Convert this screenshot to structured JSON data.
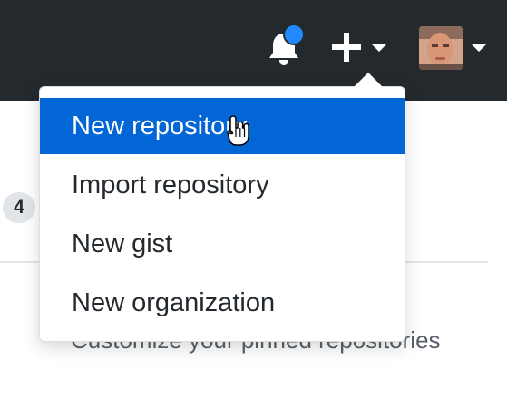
{
  "header": {
    "notifications": {
      "icon": "bell-icon",
      "has_unread": true,
      "dot_color": "#2188ff"
    },
    "create_menu": {
      "icon": "plus-icon",
      "caret_icon": "caret-down-icon"
    },
    "profile_menu": {
      "avatar": "avatar",
      "caret_icon": "caret-down-icon"
    }
  },
  "background": {
    "count_badge": "4",
    "pinned_link": "Customize your pinned repositories"
  },
  "dropdown": {
    "items": [
      {
        "label": "New repository",
        "active": true
      },
      {
        "label": "Import repository",
        "active": false
      },
      {
        "label": "New gist",
        "active": false
      },
      {
        "label": "New organization",
        "active": false
      }
    ]
  },
  "colors": {
    "header_bg": "#24292e",
    "accent": "#0366d6",
    "notification_dot": "#2188ff",
    "menu_text": "#24292e",
    "muted_text": "#586069"
  },
  "cursor": {
    "icon": "hand-pointer-icon"
  }
}
